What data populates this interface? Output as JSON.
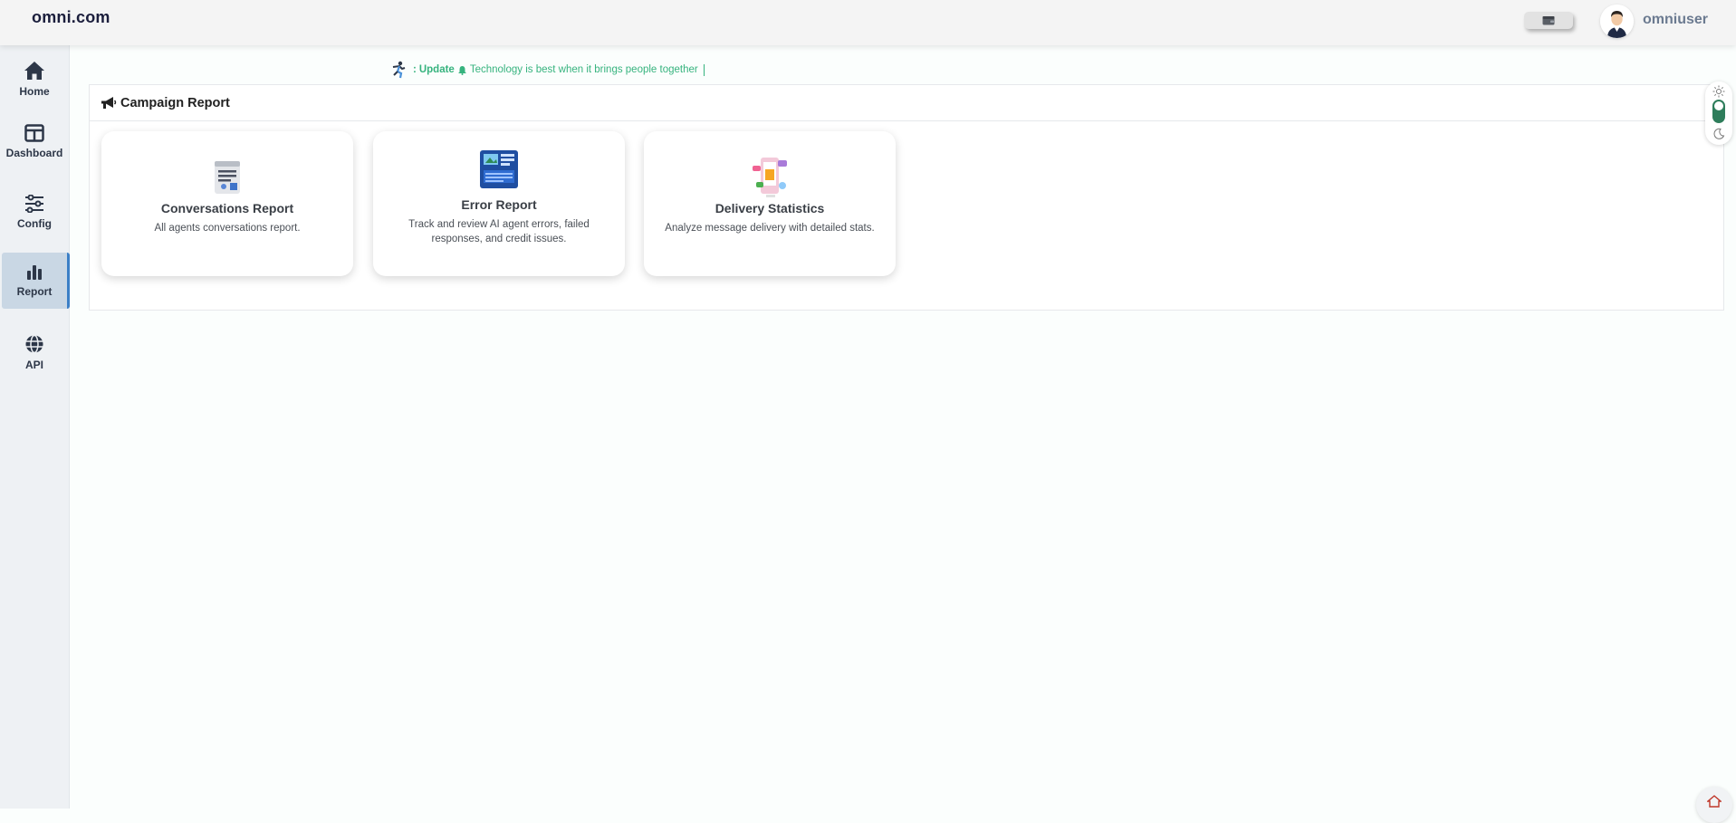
{
  "header": {
    "brand": "omni.com",
    "username": "omniuser",
    "wallet_icon": "wallet-icon",
    "avatar_icon": "user-avatar"
  },
  "sidebar": {
    "items": [
      {
        "label": "Home",
        "icon": "home-icon",
        "active": false
      },
      {
        "label": "Dashboard",
        "icon": "dashboard-icon",
        "active": false
      },
      {
        "label": "Config",
        "icon": "sliders-icon",
        "active": false
      },
      {
        "label": "Report",
        "icon": "bar-chart-icon",
        "active": true
      },
      {
        "label": "API",
        "icon": "globe-icon",
        "active": false
      }
    ]
  },
  "ticker": {
    "prefix": ":",
    "update_label": "Update",
    "bell_icon": "bell-icon",
    "message": "Technology is best when it brings people together"
  },
  "panel": {
    "title": "Campaign Report",
    "title_icon": "megaphone-icon"
  },
  "cards": [
    {
      "title": "Conversations Report",
      "description": "All agents conversations report.",
      "icon": "report-document-icon"
    },
    {
      "title": "Error Report",
      "description": "Track and review AI agent errors, failed responses, and credit issues.",
      "icon": "error-report-icon"
    },
    {
      "title": "Delivery Statistics",
      "description": "Analyze message delivery with detailed stats.",
      "icon": "delivery-stats-icon"
    }
  ],
  "theme_toggle": {
    "light_icon": "sun-icon",
    "dark_icon": "moon-icon",
    "mode": "light"
  },
  "colors": {
    "accent": "#3b7fc6",
    "ticker": "#36b37e",
    "toggle_track": "#2e7d5b",
    "sidebar_bg": "#eef1f4",
    "active_item_bg": "#c9d7e4"
  }
}
